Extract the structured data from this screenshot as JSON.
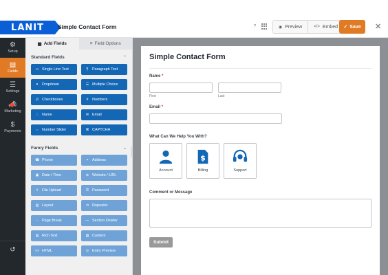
{
  "header": {
    "logo": "LANIT",
    "form_title": "Simple Contact Form",
    "help_icon": "?",
    "preview_label": "Preview",
    "embed_label": "Embed",
    "save_label": "Save",
    "close_icon": "✕"
  },
  "rail": {
    "items": [
      {
        "icon": "⚙",
        "label": "Setup",
        "name": "gear-icon"
      },
      {
        "icon": "▤",
        "label": "Fields",
        "name": "fields-icon"
      },
      {
        "icon": "☰",
        "label": "Settings",
        "name": "sliders-icon"
      },
      {
        "icon": "📣",
        "label": "Marketing",
        "name": "megaphone-icon"
      },
      {
        "icon": "$",
        "label": "Payments",
        "name": "dollar-icon"
      }
    ],
    "history_icon": "↺"
  },
  "panel": {
    "tabs": [
      {
        "icon": "▦",
        "label": "Add Fields"
      },
      {
        "icon": "≡",
        "label": "Field Options"
      }
    ],
    "standard_title": "Standard Fields",
    "standard": [
      {
        "icon": "▭",
        "label": "Single Line Text"
      },
      {
        "icon": "¶",
        "label": "Paragraph Text"
      },
      {
        "icon": "▾",
        "label": "Dropdown"
      },
      {
        "icon": "☰",
        "label": "Multiple Choice"
      },
      {
        "icon": "☑",
        "label": "Checkboxes"
      },
      {
        "icon": "#",
        "label": "Numbers"
      },
      {
        "icon": "👤",
        "label": "Name"
      },
      {
        "icon": "✉",
        "label": "Email"
      },
      {
        "icon": "⇔",
        "label": "Number Slider"
      },
      {
        "icon": "⌘",
        "label": "CAPTCHA"
      }
    ],
    "fancy_title": "Fancy Fields",
    "fancy": [
      {
        "icon": "☎",
        "label": "Phone"
      },
      {
        "icon": "⌖",
        "label": "Address"
      },
      {
        "icon": "▣",
        "label": "Date / Time"
      },
      {
        "icon": "⊕",
        "label": "Website / URL"
      },
      {
        "icon": "⇪",
        "label": "File Upload"
      },
      {
        "icon": "⚿",
        "label": "Password"
      },
      {
        "icon": "▥",
        "label": "Layout"
      },
      {
        "icon": "⟲",
        "label": "Repeater"
      },
      {
        "icon": "⋯",
        "label": "Page Break"
      },
      {
        "icon": "—",
        "label": "Section Divider"
      },
      {
        "icon": "▤",
        "label": "Rich Text"
      },
      {
        "icon": "▧",
        "label": "Content"
      },
      {
        "icon": "<>",
        "label": "HTML"
      },
      {
        "icon": "⊙",
        "label": "Entry Preview"
      }
    ]
  },
  "form": {
    "title": "Simple Contact Form",
    "name_label": "Name",
    "required_mark": "*",
    "first_sub": "First",
    "last_sub": "Last",
    "email_label": "Email",
    "help_label": "What Can We Help You With?",
    "options": [
      "Account",
      "Billing",
      "Support"
    ],
    "comment_label": "Comment or Message",
    "submit_label": "Submit"
  },
  "colors": {
    "accent": "#e07a24",
    "field_button": "#1367b5",
    "fancy_button": "#6fa3d8",
    "icon_blue": "#1367b5"
  }
}
